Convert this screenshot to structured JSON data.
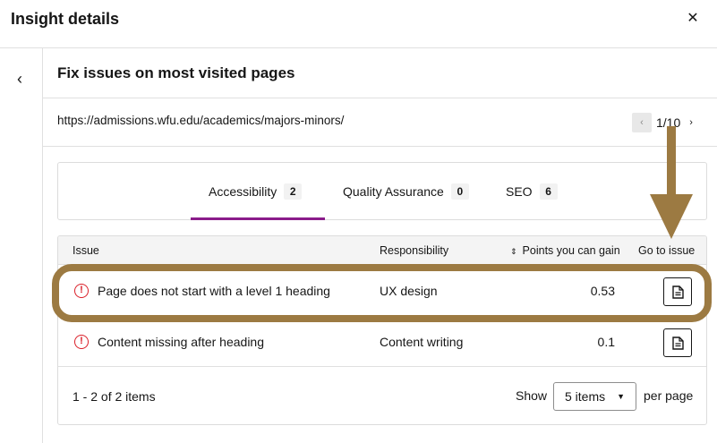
{
  "header": {
    "title": "Insight details",
    "close_glyph": "✕"
  },
  "nav": {
    "back_glyph": "‹"
  },
  "insight": {
    "title": "Fix issues on most visited pages"
  },
  "url_bar": {
    "url": "https://admissions.wfu.edu/academics/majors-minors/",
    "prev_glyph": "‹",
    "next_glyph": "›",
    "page_indicator": "1/10"
  },
  "tabs": [
    {
      "label": "Accessibility",
      "count": "2",
      "active": true
    },
    {
      "label": "Quality Assurance",
      "count": "0",
      "active": false
    },
    {
      "label": "SEO",
      "count": "6",
      "active": false
    }
  ],
  "table": {
    "headers": {
      "issue": "Issue",
      "responsibility": "Responsibility",
      "points": "Points you can gain",
      "goto": "Go to issue"
    },
    "rows": [
      {
        "issue": "Page does not start with a level 1 heading",
        "responsibility": "UX design",
        "points": "0.53",
        "icon": "warning-circle-icon"
      },
      {
        "issue": "Content missing after heading",
        "responsibility": "Content writing",
        "points": "0.1",
        "icon": "warning-circle-icon"
      }
    ]
  },
  "pagination": {
    "range": "1 - 2 of 2 items",
    "show_label": "Show",
    "selected": "5 items",
    "per_page": "per page"
  },
  "colors": {
    "accent_tab": "#8a1c8a",
    "warning": "#da1e28",
    "annotation": "#9c7a42"
  }
}
